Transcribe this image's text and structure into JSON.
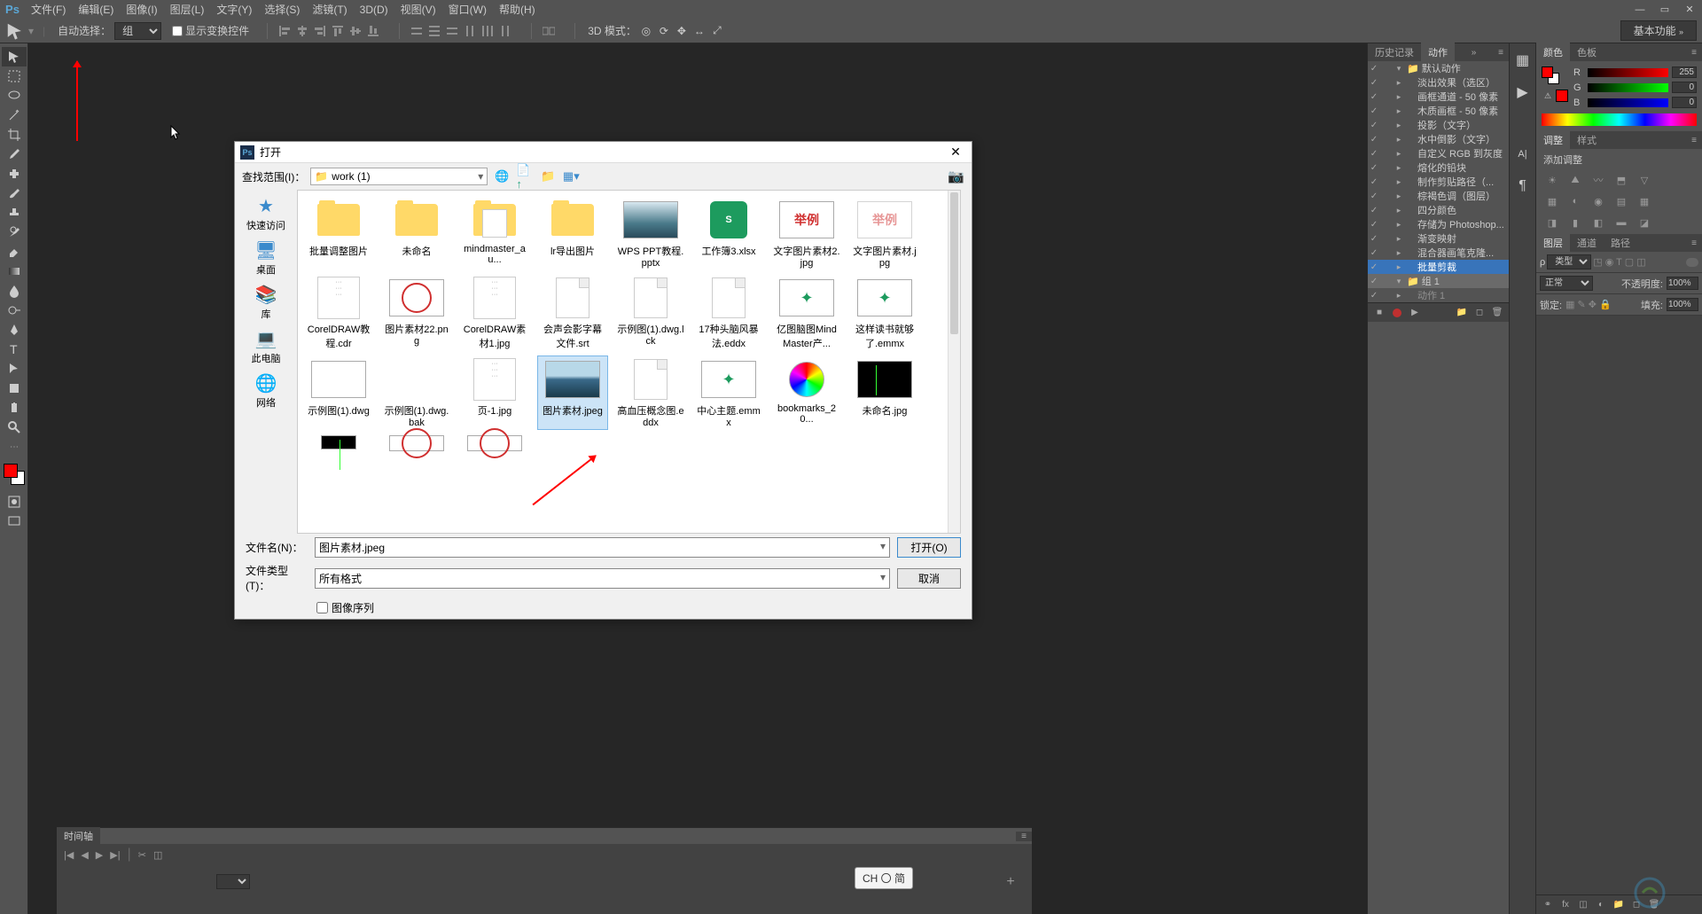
{
  "menu": {
    "logo": "Ps",
    "items": [
      "文件(F)",
      "编辑(E)",
      "图像(I)",
      "图层(L)",
      "文字(Y)",
      "选择(S)",
      "滤镜(T)",
      "3D(D)",
      "视图(V)",
      "窗口(W)",
      "帮助(H)"
    ]
  },
  "options": {
    "auto_select_label": "自动选择：",
    "auto_select_value": "组",
    "show_transform_label": "显示变换控件",
    "mode3d_label": "3D 模式：",
    "workspace": "基本功能"
  },
  "dialog": {
    "title": "打开",
    "lookin_label": "查找范围(I)：",
    "path": "work (1)",
    "sidebar": [
      {
        "icon": "★",
        "color": "#3a8acc",
        "label": "快速访问"
      },
      {
        "icon": "🖥",
        "color": "#3a8acc",
        "label": "桌面"
      },
      {
        "icon": "📚",
        "color": "#e6a817",
        "label": "库"
      },
      {
        "icon": "💻",
        "color": "#3a8acc",
        "label": "此电脑"
      },
      {
        "icon": "🌐",
        "color": "#3a8acc",
        "label": "网络"
      }
    ],
    "files_row1": [
      {
        "type": "folder",
        "name": "批量调整图片"
      },
      {
        "type": "folder",
        "name": "未命名"
      },
      {
        "type": "folder-file",
        "name": "mindmaster_au..."
      },
      {
        "type": "folder",
        "name": "lr导出图片"
      },
      {
        "type": "img-landscape",
        "name": "WPS PPT教程.pptx"
      },
      {
        "type": "xlsx",
        "name": "工作簿3.xlsx"
      },
      {
        "type": "red-ex",
        "name": "文字图片素材2.jpg"
      },
      {
        "type": "red-ex-light",
        "name": "文字图片素材.jpg"
      }
    ],
    "files_row2": [
      {
        "type": "doc-thumb",
        "name": "CorelDRAW教程.cdr"
      },
      {
        "type": "seal",
        "name": "图片素材22.png"
      },
      {
        "type": "doc-thumb",
        "name": "CorelDRAW素材1.jpg"
      },
      {
        "type": "file-doc",
        "name": "会声会影字幕文件.srt"
      },
      {
        "type": "file-doc",
        "name": "示例图(1).dwg.lck"
      },
      {
        "type": "file-doc",
        "name": "17种头脑风暴法.eddx"
      },
      {
        "type": "green",
        "name": "亿图脑图MindMaster产..."
      },
      {
        "type": "green",
        "name": "这样读书就够了.emmx"
      }
    ],
    "files_row3": [
      {
        "type": "plan",
        "name": "示例图(1).dwg"
      },
      {
        "type": "blank",
        "name": "示例图(1).dwg.bak"
      },
      {
        "type": "doc-thumb",
        "name": "页-1.jpg"
      },
      {
        "type": "landscape",
        "name": "图片素材.jpeg",
        "selected": true
      },
      {
        "type": "file-doc",
        "name": "高血压概念图.eddx"
      },
      {
        "type": "green",
        "name": "中心主题.emmx"
      },
      {
        "type": "color-wheel",
        "name": "bookmarks_20..."
      },
      {
        "type": "dark",
        "name": "未命名.jpg"
      }
    ],
    "filename_label": "文件名(N)：",
    "filename_value": "图片素材.jpeg",
    "filetype_label": "文件类型(T)：",
    "filetype_value": "所有格式",
    "open_btn": "打开(O)",
    "cancel_btn": "取消",
    "sequence_label": "图像序列"
  },
  "ex_text": "举例",
  "panels": {
    "history_tab": "历史记录",
    "actions_tab": "动作",
    "actions": [
      {
        "folder": true,
        "label": "默认动作"
      },
      {
        "label": "淡出效果（选区）"
      },
      {
        "label": "画框通道 - 50 像素"
      },
      {
        "label": "木质画框 - 50 像素"
      },
      {
        "label": "投影（文字）"
      },
      {
        "label": "水中倒影（文字）"
      },
      {
        "label": "自定义 RGB 到灰度"
      },
      {
        "label": "熔化的铅块"
      },
      {
        "label": "制作剪贴路径（..."
      },
      {
        "label": "棕褐色调（图层）"
      },
      {
        "label": "四分颜色"
      },
      {
        "label": "存储为 Photoshop..."
      },
      {
        "label": "渐变映射"
      },
      {
        "label": "混合器画笔克隆..."
      },
      {
        "label": "批量剪裁",
        "hl": true
      },
      {
        "folder": true,
        "label": "组 1",
        "hl2": true
      },
      {
        "label": "动作 1",
        "dim": true
      }
    ],
    "color_tab": "颜色",
    "swatches_tab": "色板",
    "color": {
      "r": "255",
      "g": "0",
      "b": "0"
    },
    "adjustments_tab": "调整",
    "styles_tab": "样式",
    "add_adjustment": "添加调整",
    "layers_tab": "图层",
    "channels_tab": "通道",
    "paths_tab": "路径",
    "filter_kind": "类型",
    "blend_mode": "正常",
    "opacity_label": "不透明度:",
    "opacity_value": "100%",
    "lock_label": "锁定:",
    "fill_label": "填充:",
    "fill_value": "100%"
  },
  "timeline": {
    "tab": "时间轴",
    "ime": "CH 〇 简"
  }
}
